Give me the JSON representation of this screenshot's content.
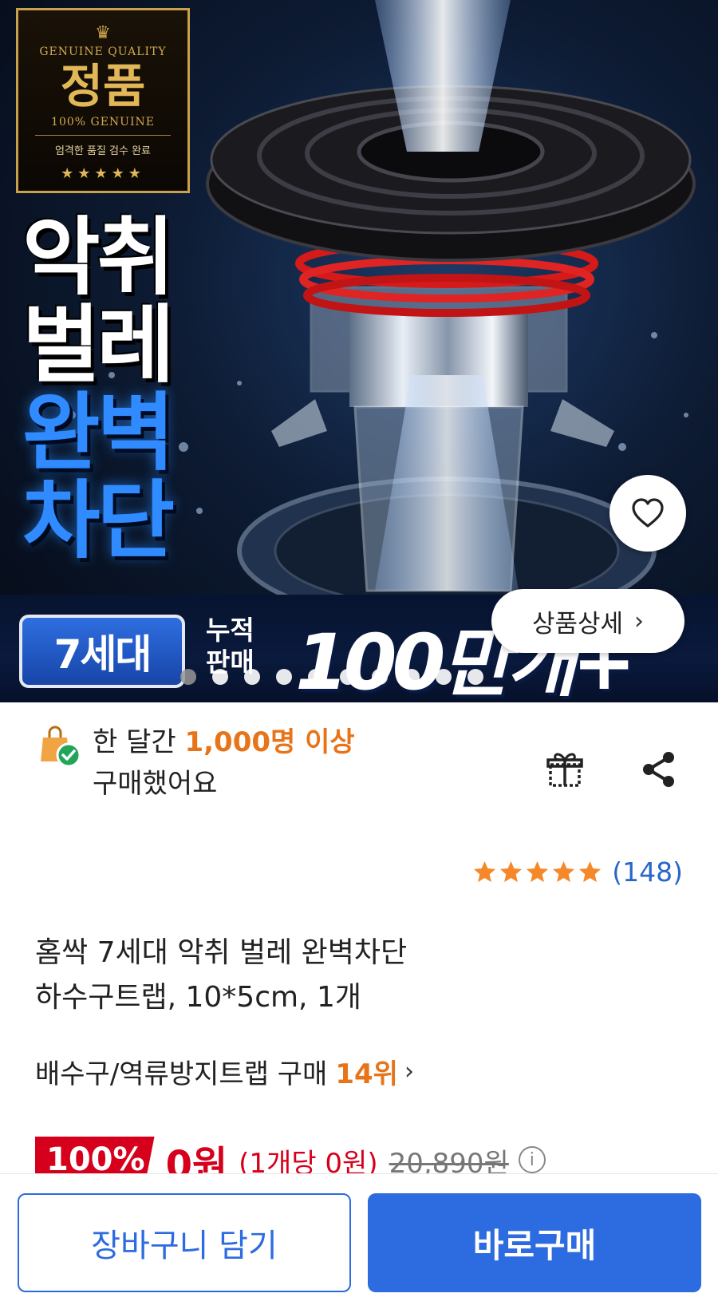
{
  "hero": {
    "badge": {
      "quality": "GENUINE QUALITY",
      "main": "정품",
      "genuine": "100% GENUINE",
      "check": "엄격한 품질 검수 완료",
      "stars": "★★★★★"
    },
    "headline": [
      "악취",
      "벌레",
      "완벽",
      "차단"
    ],
    "banner": {
      "generation": "7세대",
      "small_line1": "누적",
      "small_line2": "판매",
      "big": "100만개+"
    },
    "detail_button_label": "상품상세",
    "carousel": {
      "total": 10,
      "active_index": 0
    },
    "icons": {
      "back": "chevron-left-icon",
      "wishlist": "heart-icon",
      "detail": "chevron-right-icon"
    }
  },
  "social_proof": {
    "prefix": "한 달간 ",
    "highlight": "1,000명 이상",
    "suffix": "구매했어요",
    "icon": "shopping-bag-check-icon"
  },
  "actions": {
    "gift_icon": "gift-icon",
    "share_icon": "share-icon"
  },
  "rating": {
    "stars": 5,
    "count": "(148)"
  },
  "product": {
    "title_line1": "홈싹 7세대 악취 벌레 완벽차단",
    "title_line2": "하수구트랩, 10*5cm, 1개"
  },
  "rank": {
    "category": "배수구/역류방지트랩 구매",
    "position": "14위"
  },
  "price": {
    "discount": "100%",
    "sale": "0원",
    "unit": "(1개당 0원)",
    "original": "20,890원",
    "info_icon": "info-icon"
  },
  "bottom_bar": {
    "cart_label": "장바구니 담기",
    "buy_label": "바로구매"
  },
  "colors": {
    "accent_blue": "#2c6be0",
    "highlight_orange": "#e8741a",
    "sale_red": "#d6001c",
    "star": "#f5892a"
  }
}
